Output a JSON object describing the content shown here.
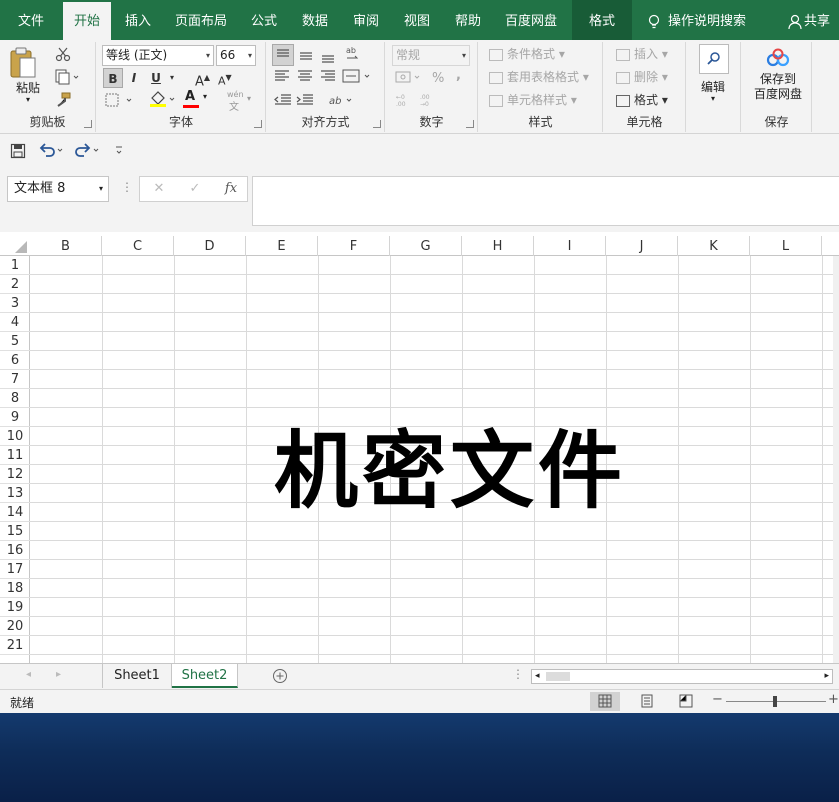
{
  "tabs": [
    "文件",
    "开始",
    "插入",
    "页面布局",
    "公式",
    "数据",
    "审阅",
    "视图",
    "帮助",
    "百度网盘",
    "格式"
  ],
  "tell_me": "操作说明搜索",
  "share": "共享",
  "ribbon": {
    "clipboard": {
      "paste": "粘贴",
      "label": "剪贴板"
    },
    "font": {
      "name": "等线 (正文)",
      "size": "66",
      "bold": "B",
      "italic": "I",
      "underline": "U",
      "grow": "A",
      "shrink": "A",
      "font_color": "A",
      "phonetic": "wén",
      "label": "字体"
    },
    "alignment": {
      "label": "对齐方式"
    },
    "number": {
      "format": "常规",
      "percent": "%",
      "comma": ",",
      "inc_dec": ".00",
      "label": "数字"
    },
    "styles": {
      "conditional": "条件格式",
      "table": "套用表格格式",
      "cell": "单元格样式",
      "label": "样式"
    },
    "cells": {
      "insert": "插入",
      "delete": "删除",
      "format": "格式",
      "label": "单元格"
    },
    "editing": {
      "label": "编辑"
    },
    "save": {
      "line1": "保存到",
      "line2": "百度网盘",
      "label": "保存"
    }
  },
  "namebox": "文本框 8",
  "fx": "fx",
  "columns": [
    "B",
    "C",
    "D",
    "E",
    "F",
    "G",
    "H",
    "I",
    "J",
    "K",
    "L"
  ],
  "rows": [
    "1",
    "2",
    "3",
    "4",
    "5",
    "6",
    "7",
    "8",
    "9",
    "10",
    "11",
    "12",
    "13",
    "14",
    "15",
    "16",
    "17",
    "18",
    "19",
    "20",
    "21"
  ],
  "textbox": "机密文件",
  "sheets": [
    "Sheet1",
    "Sheet2"
  ],
  "status": "就绪",
  "colors": {
    "accent": "#217346",
    "ctx_tab": "#185c37"
  }
}
